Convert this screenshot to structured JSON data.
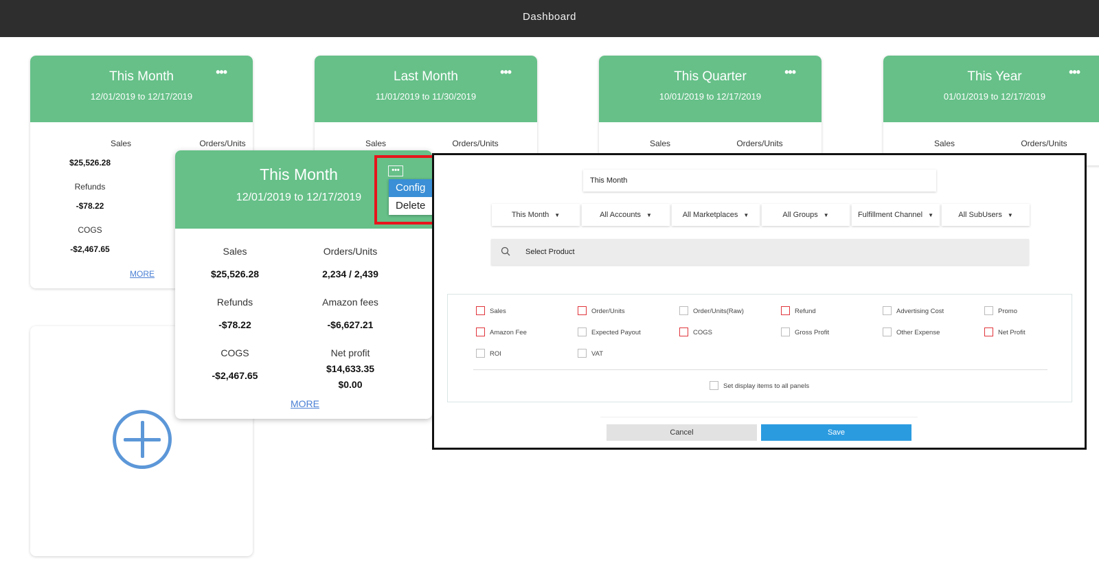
{
  "header": {
    "title": "Dashboard"
  },
  "cards": [
    {
      "title": "This Month",
      "range": "12/01/2019 to 12/17/2019",
      "sales_label": "Sales",
      "orders_label": "Orders/Units",
      "sales": "$25,526.28",
      "refunds_label": "Refunds",
      "refunds": "-$78.22",
      "cogs_label": "COGS",
      "cogs": "-$2,467.65",
      "more": "MORE"
    },
    {
      "title": "Last Month",
      "range": "11/01/2019 to 11/30/2019",
      "sales_label": "Sales",
      "orders_label": "Orders/Units"
    },
    {
      "title": "This Quarter",
      "range": "10/01/2019 to 12/17/2019",
      "sales_label": "Sales",
      "orders_label": "Orders/Units"
    },
    {
      "title": "This Year",
      "range": "01/01/2019 to 12/17/2019",
      "sales_label": "Sales",
      "orders_label": "Orders/Units"
    }
  ],
  "card_menu_icon": "more-horizontal-icon",
  "popup_card": {
    "title": "This Month",
    "range": "12/01/2019 to 12/17/2019",
    "sales_label": "Sales",
    "sales": "$25,526.28",
    "orders_label": "Orders/Units",
    "orders": "2,234 / 2,439",
    "refunds_label": "Refunds",
    "refunds": "-$78.22",
    "amazon_fees_label": "Amazon fees",
    "amazon_fees": "-$6,627.21",
    "cogs_label": "COGS",
    "cogs": "-$2,467.65",
    "net_profit_label": "Net profit",
    "net_profit": "$14,633.35",
    "extra_value": "$0.00",
    "more": "MORE"
  },
  "context_menu": {
    "config": "Config",
    "delete": "Delete"
  },
  "config_panel": {
    "panel_name": "This Month",
    "dropdowns": [
      "This Month",
      "All Accounts",
      "All Marketplaces",
      "All Groups",
      "Fulfillment Channel",
      "All SubUsers"
    ],
    "search_placeholder": "Select Product",
    "options": [
      {
        "label": "Sales",
        "checked_style": "red"
      },
      {
        "label": "Order/Units",
        "checked_style": "red"
      },
      {
        "label": "Order/Units(Raw)",
        "checked_style": "grey"
      },
      {
        "label": "Refund",
        "checked_style": "red"
      },
      {
        "label": "Advertising Cost",
        "checked_style": "grey"
      },
      {
        "label": "Promo",
        "checked_style": "grey"
      },
      {
        "label": "Amazon Fee",
        "checked_style": "red"
      },
      {
        "label": "Expected Payout",
        "checked_style": "grey"
      },
      {
        "label": "COGS",
        "checked_style": "red"
      },
      {
        "label": "Gross Profit",
        "checked_style": "grey"
      },
      {
        "label": "Other Expense",
        "checked_style": "grey"
      },
      {
        "label": "Net Profit",
        "checked_style": "red"
      },
      {
        "label": "ROI",
        "checked_style": "grey"
      },
      {
        "label": "VAT",
        "checked_style": "grey"
      }
    ],
    "apply_all_label": "Set display items to all panels",
    "cancel": "Cancel",
    "save": "Save"
  },
  "colors": {
    "card_header": "#66c088",
    "accent_blue": "#2b9be0",
    "highlight_red": "#e8151b"
  }
}
